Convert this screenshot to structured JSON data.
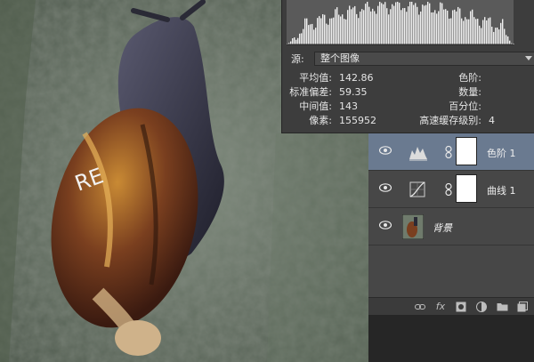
{
  "histogram": {
    "source_label": "源:",
    "source_value": "整个图像",
    "stats_left": [
      {
        "key": "平均值:",
        "value": "142.86"
      },
      {
        "key": "标准偏差:",
        "value": "59.35"
      },
      {
        "key": "中间值:",
        "value": "143"
      },
      {
        "key": "像素:",
        "value": "155952"
      }
    ],
    "stats_right": [
      {
        "key": "色阶:",
        "value": ""
      },
      {
        "key": "数量:",
        "value": ""
      },
      {
        "key": "百分位:",
        "value": ""
      },
      {
        "key": "高速缓存级别:",
        "value": "4"
      }
    ]
  },
  "layers": [
    {
      "name": "色阶 1",
      "type": "levels",
      "selected": true
    },
    {
      "name": "曲线 1",
      "type": "curves",
      "selected": false
    },
    {
      "name": "背景",
      "type": "background",
      "selected": false
    }
  ],
  "footer_icons": [
    "link-icon",
    "fx-icon",
    "mask-icon",
    "adjustment-icon",
    "folder-icon",
    "new-layer-icon"
  ],
  "footer_fx_label": "fx",
  "colors": {
    "selected_layer": "#6a7a90",
    "panel": "#474747",
    "histo_panel": "#3d3d3d"
  }
}
